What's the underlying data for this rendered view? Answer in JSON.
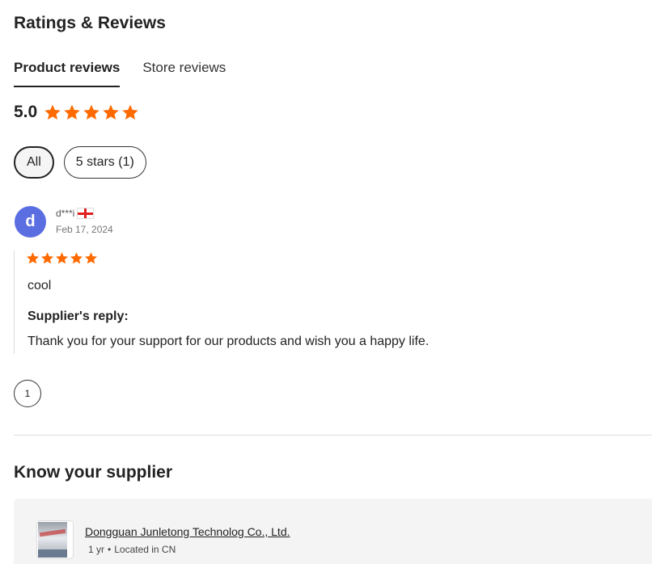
{
  "ratings_section": {
    "title": "Ratings & Reviews",
    "tabs": [
      {
        "label": "Product reviews",
        "active": true
      },
      {
        "label": "Store reviews",
        "active": false
      }
    ],
    "score": "5.0",
    "stars": 5,
    "star_color": "#ff6a00",
    "filters": [
      {
        "label": "All",
        "selected": true
      },
      {
        "label": "5 stars (1)",
        "selected": false
      }
    ]
  },
  "reviews": [
    {
      "avatar_letter": "d",
      "avatar_color": "#5b6ee1",
      "reviewer": "d***i",
      "country_flag": "georgia-flag-icon",
      "date": "Feb 17, 2024",
      "stars": 5,
      "text": "cool",
      "reply_label": "Supplier's reply:",
      "reply_text": "Thank you for your support for our products and wish you a happy life."
    }
  ],
  "pagination": {
    "current_page": "1"
  },
  "supplier_section": {
    "title": "Know your supplier",
    "name": "Dongguan Junletong Technolog Co., Ltd.",
    "years": "1 yr",
    "separator": "•",
    "location": "Located in CN"
  }
}
